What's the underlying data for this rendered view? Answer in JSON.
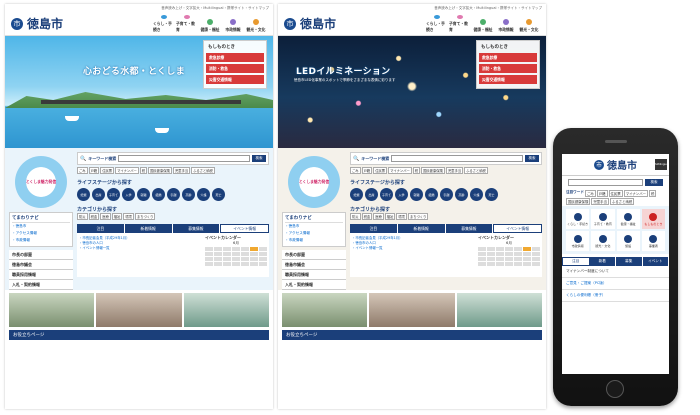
{
  "site": {
    "logo_text": "徳島市",
    "logo_mark": "市"
  },
  "top_links": "音声読み上げ・文字拡大・Multilingual・携帯サイト・サイトマップ",
  "gnav": [
    {
      "label": "くらし・手続き",
      "color": "#3a9ad9"
    },
    {
      "label": "子育て・教育",
      "color": "#e07ab0"
    },
    {
      "label": "健康・福祉",
      "color": "#4caf6a"
    },
    {
      "label": "市政情報",
      "color": "#8a6fc8"
    },
    {
      "label": "観光・文化",
      "color": "#e89a30"
    }
  ],
  "hero_a": {
    "title": "心おどる水都・とくしま"
  },
  "hero_b": {
    "title": "LEDイルミネーション",
    "subtitle": "徳島市LED化事業のスポットで季節をさまざまな表情に彩ります"
  },
  "emergency": {
    "title": "もしものとき",
    "items": [
      "救急診療",
      "消防・救急",
      "災害交通情報"
    ]
  },
  "left": {
    "badge_text": "とくしま魅力発信",
    "navi_title": "てまわりナビ",
    "navi_rows": [
      "・徳島市",
      "・アクセス情報",
      "・市政情報"
    ],
    "nav_items": [
      "市長の部屋",
      "徳島市議会",
      "職員採用情報",
      "入札・契約情報"
    ]
  },
  "search": {
    "label": "キーワード検索",
    "placeholder": "",
    "button": "検索"
  },
  "tags": [
    "ごみ",
    "戸籍",
    "住民票",
    "マイナンバー",
    "税",
    "国民健康保険",
    "児童手当",
    "ふるさと納税"
  ],
  "life": {
    "title": "ライフステージから探す",
    "items": [
      "妊娠",
      "出産",
      "子育て",
      "入学",
      "就職",
      "結婚",
      "引越",
      "高齢",
      "介護",
      "死亡"
    ]
  },
  "category": {
    "title": "カテゴリから探す",
    "items": [
      "防災",
      "税金",
      "医療",
      "福祉",
      "環境",
      "まちづくり"
    ]
  },
  "tabs": [
    "注目",
    "新着情報",
    "募集情報",
    "イベント情報"
  ],
  "news_rows": [
    "・市長記者会見（平成29年1月）",
    "・徳島市の人口",
    "・イベント情報一覧"
  ],
  "calendar": {
    "title": "イベントカレンダー",
    "month": "6月"
  },
  "footer_title": "お役立ちページ",
  "mobile": {
    "logo_text": "徳島市",
    "lang": "Multilingual",
    "search_button": "検索",
    "tags_label": "注目ワード",
    "tags": [
      "ごみ",
      "戸籍",
      "住民票",
      "マイナンバー",
      "税",
      "国民健康保険",
      "児童手当",
      "ふるさと納税"
    ],
    "grid": [
      {
        "label": "くらし・手続き",
        "red": false
      },
      {
        "label": "子育て・教育",
        "red": false
      },
      {
        "label": "健康・福祉",
        "red": false
      },
      {
        "label": "もしものとき",
        "red": true
      },
      {
        "label": "市政情報",
        "red": false
      },
      {
        "label": "観光・文化",
        "red": false
      },
      {
        "label": "施設",
        "red": false
      },
      {
        "label": "事業者",
        "red": false
      }
    ],
    "tabs": [
      "注目",
      "新着",
      "募集",
      "イベント"
    ],
    "rows": [
      "マイナンバー制度について",
      "ご意見・ご提案（PC版）",
      "くらしの便利帳（冊子）"
    ]
  }
}
